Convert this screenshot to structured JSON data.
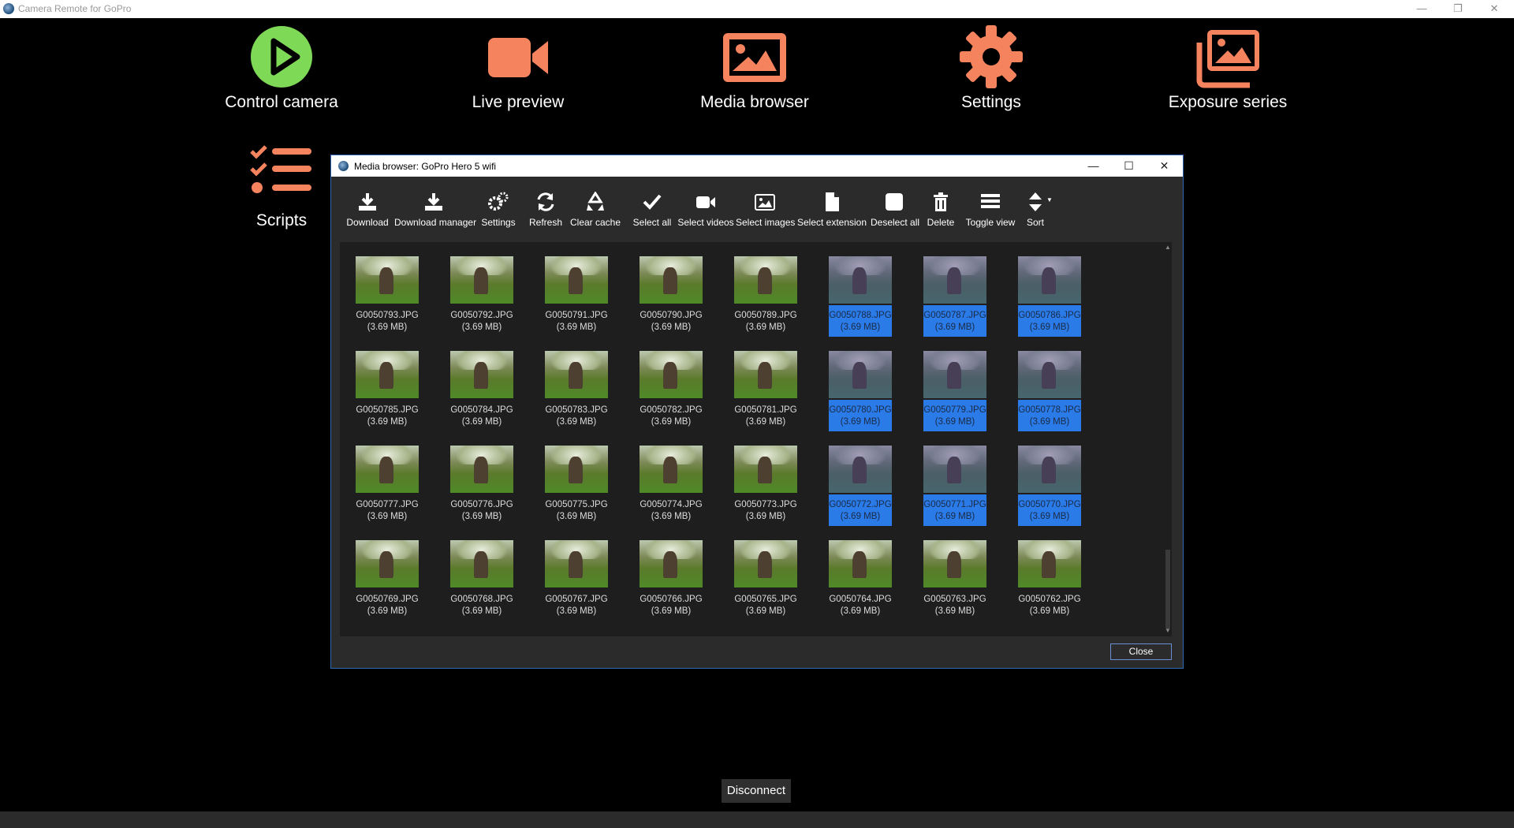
{
  "app": {
    "title": "Camera Remote for GoPro",
    "window_buttons": [
      "—",
      "❐",
      "✕"
    ]
  },
  "tiles": [
    {
      "label": "Control camera",
      "icon": "play-circle-icon",
      "color": "#7ed957"
    },
    {
      "label": "Live preview",
      "icon": "video-camera-icon",
      "color": "#f5845e"
    },
    {
      "label": "Media browser",
      "icon": "image-icon",
      "color": "#f5845e"
    },
    {
      "label": "Settings",
      "icon": "gear-icon",
      "color": "#f5845e"
    },
    {
      "label": "Exposure series",
      "icon": "image-stack-icon",
      "color": "#f5845e"
    },
    {
      "label": "Scripts",
      "icon": "checklist-icon",
      "color": "#f5845e"
    }
  ],
  "dialog": {
    "title": "Media browser: GoPro Hero 5 wifi",
    "window_buttons": [
      "—",
      "☐",
      "✕"
    ],
    "toolbar": [
      {
        "label": "Download",
        "icon": "download-icon"
      },
      {
        "label": "Download manager",
        "icon": "download-manager-icon"
      },
      {
        "label": "Settings",
        "icon": "gears-icon"
      },
      {
        "label": "Refresh",
        "icon": "refresh-icon"
      },
      {
        "label": "Clear cache",
        "icon": "recycle-icon"
      },
      {
        "label": "Select all",
        "icon": "checkmark-icon"
      },
      {
        "label": "Select videos",
        "icon": "video-camera-icon"
      },
      {
        "label": "Select images",
        "icon": "image-icon"
      },
      {
        "label": "Select extension",
        "icon": "file-icon"
      },
      {
        "label": "Deselect all",
        "icon": "square-icon"
      },
      {
        "label": "Delete",
        "icon": "trash-icon"
      },
      {
        "label": "Toggle view",
        "icon": "list-icon"
      },
      {
        "label": "Sort",
        "icon": "sort-icon"
      }
    ],
    "files": [
      {
        "name": "G0050793.JPG",
        "size": "(3.69 MB)",
        "selected": false
      },
      {
        "name": "G0050792.JPG",
        "size": "(3.69 MB)",
        "selected": false
      },
      {
        "name": "G0050791.JPG",
        "size": "(3.69 MB)",
        "selected": false
      },
      {
        "name": "G0050790.JPG",
        "size": "(3.69 MB)",
        "selected": false
      },
      {
        "name": "G0050789.JPG",
        "size": "(3.69 MB)",
        "selected": false
      },
      {
        "name": "G0050788.JPG",
        "size": "(3.69 MB)",
        "selected": true
      },
      {
        "name": "G0050787.JPG",
        "size": "(3.69 MB)",
        "selected": true
      },
      {
        "name": "G0050786.JPG",
        "size": "(3.69 MB)",
        "selected": true
      },
      {
        "name": "G0050785.JPG",
        "size": "(3.69 MB)",
        "selected": false
      },
      {
        "name": "G0050784.JPG",
        "size": "(3.69 MB)",
        "selected": false
      },
      {
        "name": "G0050783.JPG",
        "size": "(3.69 MB)",
        "selected": false
      },
      {
        "name": "G0050782.JPG",
        "size": "(3.69 MB)",
        "selected": false
      },
      {
        "name": "G0050781.JPG",
        "size": "(3.69 MB)",
        "selected": false
      },
      {
        "name": "G0050780.JPG",
        "size": "(3.69 MB)",
        "selected": true
      },
      {
        "name": "G0050779.JPG",
        "size": "(3.69 MB)",
        "selected": true
      },
      {
        "name": "G0050778.JPG",
        "size": "(3.69 MB)",
        "selected": true
      },
      {
        "name": "G0050777.JPG",
        "size": "(3.69 MB)",
        "selected": false
      },
      {
        "name": "G0050776.JPG",
        "size": "(3.69 MB)",
        "selected": false
      },
      {
        "name": "G0050775.JPG",
        "size": "(3.69 MB)",
        "selected": false
      },
      {
        "name": "G0050774.JPG",
        "size": "(3.69 MB)",
        "selected": false
      },
      {
        "name": "G0050773.JPG",
        "size": "(3.69 MB)",
        "selected": false
      },
      {
        "name": "G0050772.JPG",
        "size": "(3.69 MB)",
        "selected": true
      },
      {
        "name": "G0050771.JPG",
        "size": "(3.69 MB)",
        "selected": true
      },
      {
        "name": "G0050770.JPG",
        "size": "(3.69 MB)",
        "selected": true
      },
      {
        "name": "G0050769.JPG",
        "size": "(3.69 MB)",
        "selected": false
      },
      {
        "name": "G0050768.JPG",
        "size": "(3.69 MB)",
        "selected": false
      },
      {
        "name": "G0050767.JPG",
        "size": "(3.69 MB)",
        "selected": false
      },
      {
        "name": "G0050766.JPG",
        "size": "(3.69 MB)",
        "selected": false
      },
      {
        "name": "G0050765.JPG",
        "size": "(3.69 MB)",
        "selected": false
      },
      {
        "name": "G0050764.JPG",
        "size": "(3.69 MB)",
        "selected": false
      },
      {
        "name": "G0050763.JPG",
        "size": "(3.69 MB)",
        "selected": false
      },
      {
        "name": "G0050762.JPG",
        "size": "(3.69 MB)",
        "selected": false
      }
    ],
    "close_label": "Close",
    "selection_color": "#2a7be8"
  },
  "disconnect_label": "Disconnect"
}
